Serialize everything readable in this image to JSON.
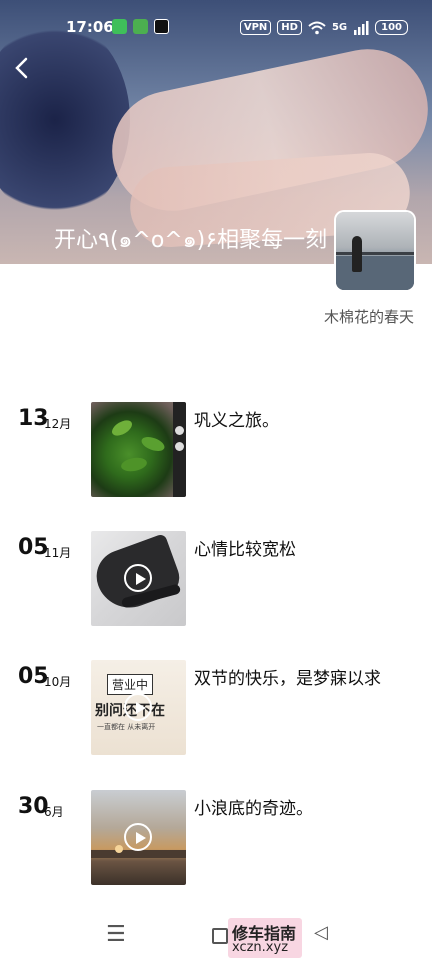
{
  "status": {
    "time": "17:06",
    "vpn": "VPN",
    "hd": "HD",
    "net": "5G",
    "battery": "100"
  },
  "album": {
    "title": "开心٩(๑^o^๑)۶相聚每一刻",
    "owner": "木棉花的春天"
  },
  "entries": [
    {
      "day": "13",
      "month": "12月",
      "caption": "巩义之旅。",
      "video": false
    },
    {
      "day": "05",
      "month": "11月",
      "caption": "心情比较宽松",
      "video": true
    },
    {
      "day": "05",
      "month": "10月",
      "caption": "双节的快乐，是梦寐以求",
      "video": true,
      "thumb_text": [
        "营业中",
        "别问还不在",
        "一直都在 从未离开"
      ]
    },
    {
      "day": "30",
      "month": "6月",
      "caption": "小浪底的奇迹。",
      "video": true
    }
  ],
  "nav": {
    "menu_icon": "☰",
    "back_icon": "◁"
  },
  "watermark": {
    "title": "修车指南",
    "url": "xczn.xyz"
  },
  "icons": [
    "back-icon",
    "play-icon",
    "wechat-icon",
    "tiktok-icon",
    "wifi-icon",
    "signal-icon",
    "battery-icon",
    "menu-icon",
    "home-icon",
    "nav-back-icon"
  ]
}
